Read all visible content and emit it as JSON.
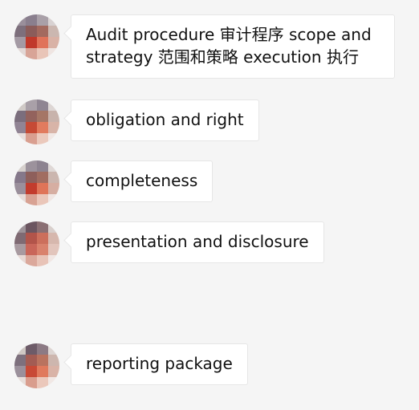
{
  "messages": [
    {
      "text": "Audit procedure 审计程序 scope and strategy 范围和策略 execution 执行"
    },
    {
      "text": "obligation and right"
    },
    {
      "text": "completeness"
    },
    {
      "text": "presentation and disclosure"
    },
    {
      "text": "reporting package"
    }
  ],
  "colors": {
    "background": "#f5f5f5",
    "bubble": "#ffffff",
    "bubble_border": "#e6e6e6",
    "text": "#111111"
  },
  "icons": {
    "avatar": "pixelated-avatar-icon"
  }
}
